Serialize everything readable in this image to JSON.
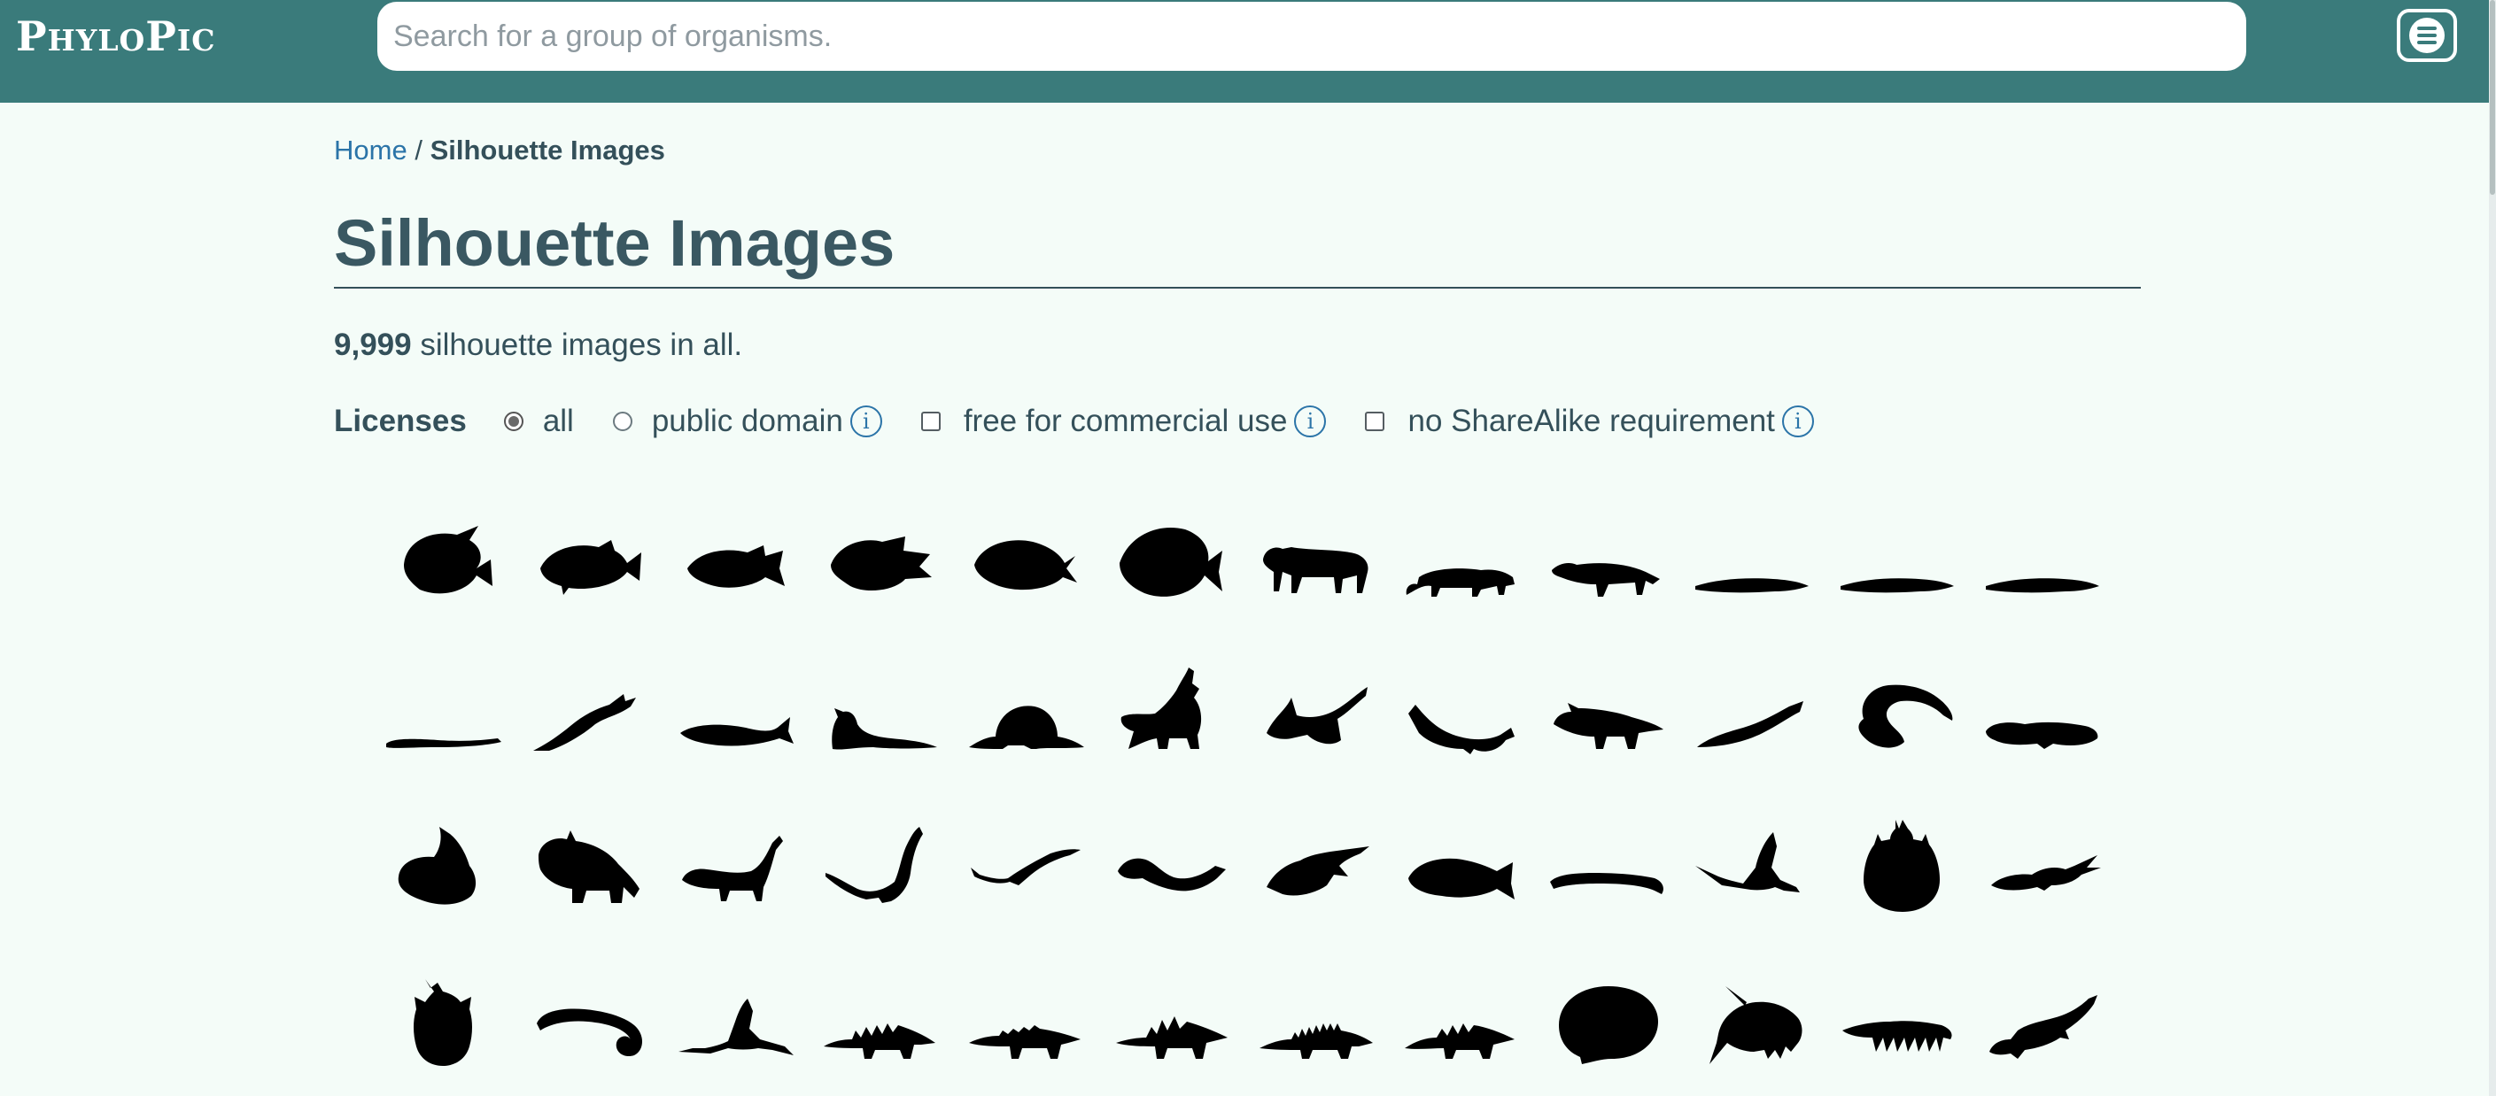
{
  "header": {
    "logo_cap1": "P",
    "logo_rest1": "HYLO",
    "logo_cap2": "P",
    "logo_rest2": "IC",
    "search_placeholder": "Search for a group of organisms.",
    "menu_icon": "hamburger-menu-icon"
  },
  "breadcrumb": {
    "home": "Home",
    "separator": "/",
    "current": "Silhouette Images"
  },
  "page": {
    "title": "Silhouette Images",
    "count": "9,999",
    "count_suffix": "silhouette images in all."
  },
  "licenses": {
    "label": "Licenses",
    "options": [
      {
        "label": "all",
        "type": "radio",
        "checked": true
      },
      {
        "label": "public domain",
        "type": "radio",
        "checked": false,
        "info": "ⓘ"
      },
      {
        "label": "free for commercial use",
        "type": "checkbox",
        "checked": false,
        "info": "ⓘ"
      },
      {
        "label": "no ShareAlike requirement",
        "type": "checkbox",
        "checked": false,
        "info": "ⓘ"
      }
    ]
  },
  "silhouettes": [
    "butterflyfish",
    "reef-fish",
    "perch",
    "cichlid",
    "tang",
    "angelfish",
    "sabertooth-cat",
    "mongoose",
    "civet",
    "eel-like-fish",
    "eel-like-fish",
    "eel-like-fish",
    "worm-fish",
    "plesiosaur",
    "ichthyosaur",
    "aquatic-mammal",
    "dimetrodon",
    "spiny-dinosaur",
    "pterosaur",
    "swimming-reptile",
    "ceratopsian",
    "mosasaur",
    "coiled-creature",
    "salamander",
    "whale",
    "triceratops",
    "long-neck-dinosaur",
    "plesiosaur-long",
    "pterosaur-small",
    "salamander-swimming",
    "trilobite-like",
    "carp",
    "worm",
    "mayfly",
    "beetle",
    "shrimp",
    "water-bug",
    "leech",
    "mayfly-small",
    "stegosaur",
    "ankylosaur",
    "kentrosaurus",
    "stegosaur-spiky",
    "stegosaur-small",
    "tick",
    "amphipod",
    "isopod-chain",
    "newt"
  ],
  "colors": {
    "header_bg": "#3a7b7b",
    "page_bg": "#f4fcf8",
    "text": "#34505a",
    "link": "#2b74a8",
    "silhouette": "#000000"
  }
}
